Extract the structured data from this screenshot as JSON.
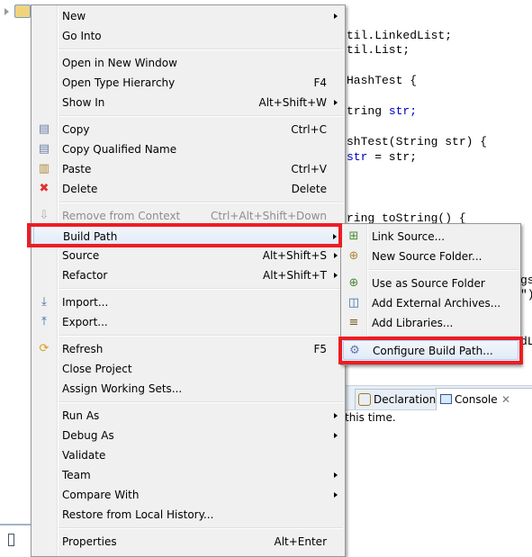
{
  "editor": {
    "code_lines": [
      {
        "text": "til.LinkedList;"
      },
      {
        "text": "til.List;"
      },
      {
        "text": "HashTest {"
      },
      {
        "text": "tring ",
        "blue": "str;"
      },
      {
        "text": "shTest(String str) {"
      },
      {
        "text": "",
        "blue": "str",
        "rest": " = str;"
      },
      {
        "text": "ring toString() {"
      },
      {
        "text": "gs"
      },
      {
        "text": "\")"
      },
      {
        "text": "dL"
      }
    ]
  },
  "bottom_panel": {
    "tabs": [
      {
        "label": "Declaration"
      },
      {
        "label": "Console"
      }
    ],
    "console_text": "this time."
  },
  "context_menu": {
    "items": [
      {
        "label": "New",
        "submenu": true
      },
      {
        "label": "Go Into"
      },
      {
        "label": "Open in New Window"
      },
      {
        "label": "Open Type Hierarchy",
        "shortcut": "F4"
      },
      {
        "label": "Show In",
        "shortcut": "Alt+Shift+W",
        "submenu": true
      },
      {
        "label": "Copy",
        "shortcut": "Ctrl+C",
        "icon": "copy-icon"
      },
      {
        "label": "Copy Qualified Name",
        "icon": "copy-qualified-name-icon"
      },
      {
        "label": "Paste",
        "shortcut": "Ctrl+V",
        "icon": "paste-icon"
      },
      {
        "label": "Delete",
        "shortcut": "Delete",
        "icon": "delete-icon"
      },
      {
        "label": "Remove from Context",
        "shortcut": "Ctrl+Alt+Shift+Down",
        "disabled": true,
        "icon": "remove-context-icon"
      },
      {
        "label": "Build Path",
        "submenu": true,
        "highlighted": true
      },
      {
        "label": "Source",
        "shortcut": "Alt+Shift+S",
        "submenu": true
      },
      {
        "label": "Refactor",
        "shortcut": "Alt+Shift+T",
        "submenu": true
      },
      {
        "label": "Import...",
        "icon": "import-icon"
      },
      {
        "label": "Export...",
        "icon": "export-icon"
      },
      {
        "label": "Refresh",
        "shortcut": "F5",
        "icon": "refresh-icon"
      },
      {
        "label": "Close Project"
      },
      {
        "label": "Assign Working Sets..."
      },
      {
        "label": "Run As",
        "submenu": true
      },
      {
        "label": "Debug As",
        "submenu": true
      },
      {
        "label": "Validate"
      },
      {
        "label": "Team",
        "submenu": true
      },
      {
        "label": "Compare With",
        "submenu": true
      },
      {
        "label": "Restore from Local History..."
      },
      {
        "label": "Properties",
        "shortcut": "Alt+Enter"
      }
    ]
  },
  "build_path_submenu": {
    "items": [
      {
        "label": "Link Source...",
        "icon": "link-source-icon"
      },
      {
        "label": "New Source Folder...",
        "icon": "new-source-folder-icon"
      },
      {
        "label": "Use as Source Folder",
        "icon": "use-source-folder-icon"
      },
      {
        "label": "Add External Archives...",
        "icon": "archive-icon"
      },
      {
        "label": "Add Libraries...",
        "icon": "libraries-icon"
      },
      {
        "label": "Configure Build Path...",
        "icon": "configure-build-path-icon",
        "highlighted": true
      }
    ]
  },
  "colors": {
    "highlight_box": "#ed1c24",
    "menu_bg": "#f0f0f0"
  }
}
